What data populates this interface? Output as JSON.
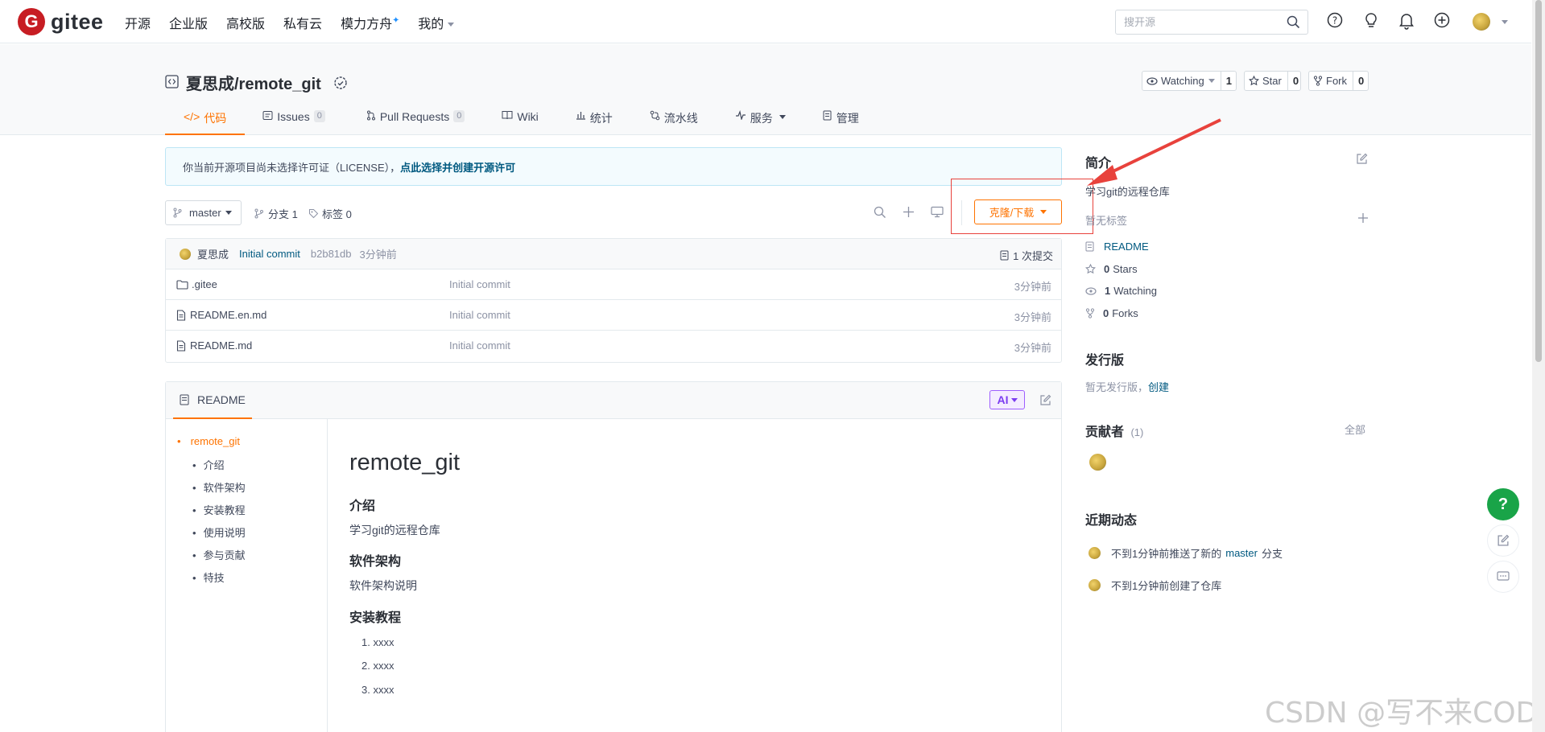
{
  "topnav": {
    "brand": "gitee",
    "items": [
      "开源",
      "企业版",
      "高校版",
      "私有云",
      "模力方舟",
      "我的"
    ],
    "search_placeholder": "搜开源"
  },
  "repo": {
    "title": "夏思成/remote_git",
    "watch_label": "Watching",
    "watch_count": "1",
    "star_label": "Star",
    "star_count": "0",
    "fork_label": "Fork",
    "fork_count": "0",
    "tabs": [
      {
        "label": "代码",
        "active": true
      },
      {
        "label": "Issues",
        "badge": "0"
      },
      {
        "label": "Pull Requests",
        "badge": "0"
      },
      {
        "label": "Wiki"
      },
      {
        "label": "统计"
      },
      {
        "label": "流水线"
      },
      {
        "label": "服务"
      },
      {
        "label": "管理"
      }
    ]
  },
  "banner": {
    "text": "你当前开源项目尚未选择许可证（LICENSE），",
    "link": "点此选择并创建开源许可"
  },
  "branch": {
    "current": "master",
    "branches_label": "分支 1",
    "tags_label": "标签 0",
    "clone_label": "克隆/下载"
  },
  "commit": {
    "author": "夏思成",
    "message": "Initial commit",
    "sha": "b2b81db",
    "time": "3分钟前",
    "count_label": "1 次提交"
  },
  "files": [
    {
      "name": ".gitee",
      "type": "folder",
      "commit": "Initial commit",
      "time": "3分钟前"
    },
    {
      "name": "README.en.md",
      "type": "file",
      "commit": "Initial commit",
      "time": "3分钟前"
    },
    {
      "name": "README.md",
      "type": "file",
      "commit": "Initial commit",
      "time": "3分钟前"
    }
  ],
  "readme": {
    "tab_label": "README",
    "ai_label": "AI",
    "toc_root": "remote_git",
    "toc": [
      "介绍",
      "软件架构",
      "安装教程",
      "使用说明",
      "参与贡献",
      "特技"
    ],
    "h1": "remote_git",
    "h_intro": "介绍",
    "p_intro": "学习git的远程仓库",
    "h_arch": "软件架构",
    "p_arch": "软件架构说明",
    "h_install": "安装教程",
    "steps": [
      "1. xxxx",
      "2. xxxx",
      "3. xxxx"
    ]
  },
  "sidebar": {
    "about_title": "简介",
    "description": "学习git的远程仓库",
    "no_tags": "暂无标签",
    "readme_link": "README",
    "stars_count": "0",
    "stars_label": "Stars",
    "watching_count": "1",
    "watching_label": "Watching",
    "forks_count": "0",
    "forks_label": "Forks",
    "releases_title": "发行版",
    "no_releases": "暂无发行版，",
    "create_link": "创建",
    "contributors_title": "贡献者",
    "contributors_count": "(1)",
    "all_link": "全部",
    "activity_title": "近期动态",
    "activity_1_prefix": "不到1分钟前推送了新的",
    "activity_1_branch": "master",
    "activity_1_suffix": "分支",
    "activity_2": "不到1分钟前创建了仓库"
  },
  "watermark": "CSDN @写不来CODE",
  "colors": {
    "accent": "#fe7300",
    "brand": "#c71d23",
    "link": "#005980",
    "help_fab": "#19a448",
    "annotation": "#e8423c"
  }
}
